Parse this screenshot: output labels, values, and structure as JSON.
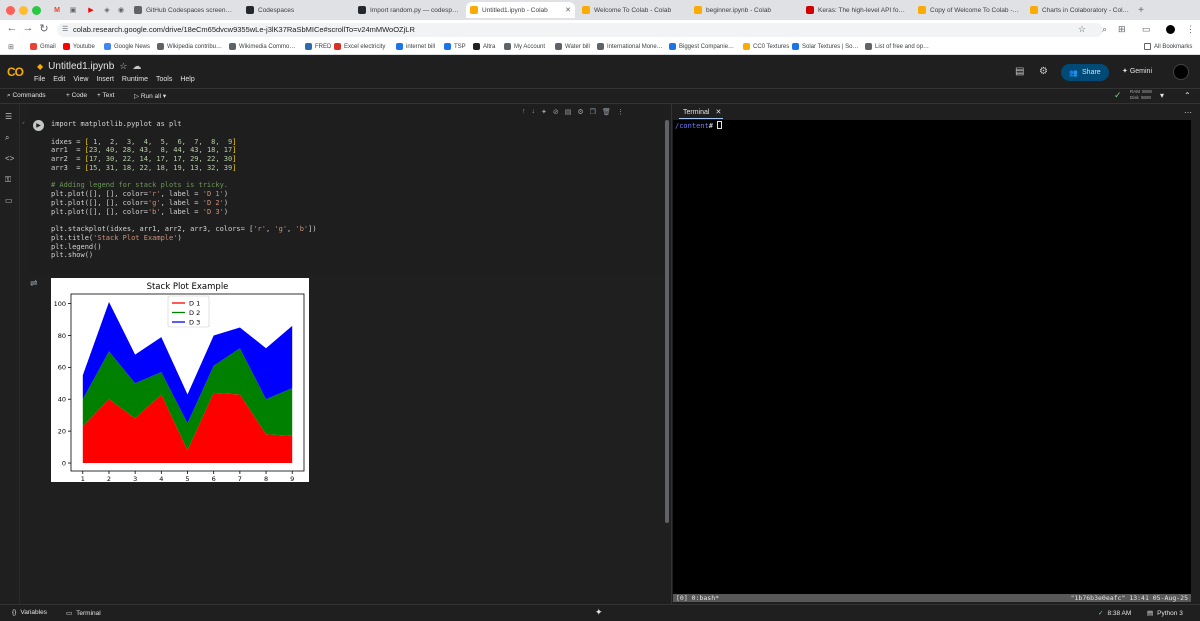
{
  "browser": {
    "tabs": [
      {
        "title": "GitHub Codespaces screens…",
        "icon": "wikipedia-icon",
        "color": "#5f6368",
        "active": false
      },
      {
        "title": "Codespaces",
        "icon": "github-icon",
        "color": "#24292f",
        "active": false
      },
      {
        "title": "Import random.py — codesp…",
        "icon": "github-icon",
        "color": "#24292f",
        "active": false
      },
      {
        "title": "Untitled1.ipynb - Colab",
        "icon": "colab-icon",
        "color": "#f9ab00",
        "active": true
      },
      {
        "title": "Welcome To Colab - Colab",
        "icon": "colab-icon",
        "color": "#f9ab00",
        "active": false
      },
      {
        "title": "beginner.ipynb - Colab",
        "icon": "colab-icon",
        "color": "#f9ab00",
        "active": false
      },
      {
        "title": "Keras: The high-level API fo…",
        "icon": "keras-icon",
        "color": "#d00000",
        "active": false
      },
      {
        "title": "Copy of Welcome To Colab -…",
        "icon": "colab-icon",
        "color": "#f9ab00",
        "active": false
      },
      {
        "title": "Charts in Colaboratory - Col…",
        "icon": "colab-icon",
        "color": "#f9ab00",
        "active": false
      }
    ],
    "url": "colab.research.google.com/drive/18eCm65dvcw9355wLe-j3lK37RaSbMICe#scrollTo=v24mMWoOZjLR",
    "bookmarks": [
      {
        "label": "Gmail",
        "color": "#ea4335"
      },
      {
        "label": "Youtube",
        "color": "#ff0000"
      },
      {
        "label": "Google News",
        "color": "#4285f4"
      },
      {
        "label": "Wikipedia contribu…",
        "color": "#5f6368"
      },
      {
        "label": "Wikimedia Commo…",
        "color": "#5f6368"
      },
      {
        "label": "FRED",
        "color": "#2b6cb0"
      },
      {
        "label": "Excel electricity",
        "color": "#d93025"
      },
      {
        "label": "internet bill",
        "color": "#1a73e8"
      },
      {
        "label": "TSP",
        "color": "#1a73e8"
      },
      {
        "label": "Altra",
        "color": "#202124"
      },
      {
        "label": "My Account",
        "color": "#5f6368"
      },
      {
        "label": "Water bill",
        "color": "#5f6368"
      },
      {
        "label": "International Mone…",
        "color": "#5f6368"
      },
      {
        "label": "Biggest Companie…",
        "color": "#1a73e8"
      },
      {
        "label": "CC0 Textures",
        "color": "#f9ab00"
      },
      {
        "label": "Solar Textures | So…",
        "color": "#1a73e8"
      },
      {
        "label": "List of free and op…",
        "color": "#5f6368"
      }
    ],
    "all_bookmarks": "All Bookmarks"
  },
  "colab": {
    "title": "Untitled1.ipynb",
    "menus": [
      "File",
      "Edit",
      "View",
      "Insert",
      "Runtime",
      "Tools",
      "Help"
    ],
    "share": "Share",
    "gemini": "Gemini",
    "toolbar": {
      "commands": "Commands",
      "code": "+ Code",
      "text": "+ Text",
      "run_all": "Run all"
    },
    "ram_label": "RAM",
    "disk_label": "Disk",
    "accent": "#f9ab00"
  },
  "cell": {
    "lines": [
      [
        {
          "t": "import matplotlib.pyplot as plt",
          "c": ""
        }
      ],
      [
        {
          "t": "",
          "c": ""
        }
      ],
      [
        {
          "t": "idxes = ",
          "c": ""
        },
        {
          "t": "[",
          "c": "brk"
        },
        {
          "t": " 1,  2,  3,  4,  5,  6,  7,  8,  9",
          "c": "num"
        },
        {
          "t": "]",
          "c": "brk"
        }
      ],
      [
        {
          "t": "arr1  = ",
          "c": ""
        },
        {
          "t": "[",
          "c": "brk"
        },
        {
          "t": "23, 40, 28, 43,  8, 44, 43, 18, 17",
          "c": "num"
        },
        {
          "t": "]",
          "c": "brk"
        }
      ],
      [
        {
          "t": "arr2  = ",
          "c": ""
        },
        {
          "t": "[",
          "c": "brk"
        },
        {
          "t": "17, 30, 22, 14, 17, 17, 29, 22, 30",
          "c": "num"
        },
        {
          "t": "]",
          "c": "brk"
        }
      ],
      [
        {
          "t": "arr3  = ",
          "c": ""
        },
        {
          "t": "[",
          "c": "brk"
        },
        {
          "t": "15, 31, 18, 22, 18, 19, 13, 32, 39",
          "c": "num"
        },
        {
          "t": "]",
          "c": "brk"
        }
      ],
      [
        {
          "t": "",
          "c": ""
        }
      ],
      [
        {
          "t": "# Adding legend for stack plots is tricky.",
          "c": "cm"
        }
      ],
      [
        {
          "t": "plt.plot([], [], color=",
          "c": ""
        },
        {
          "t": "'r'",
          "c": "str"
        },
        {
          "t": ", label = ",
          "c": ""
        },
        {
          "t": "'D 1'",
          "c": "str"
        },
        {
          "t": ")",
          "c": ""
        }
      ],
      [
        {
          "t": "plt.plot([], [], color=",
          "c": ""
        },
        {
          "t": "'g'",
          "c": "str"
        },
        {
          "t": ", label = ",
          "c": ""
        },
        {
          "t": "'D 2'",
          "c": "str"
        },
        {
          "t": ")",
          "c": ""
        }
      ],
      [
        {
          "t": "plt.plot([], [], color=",
          "c": ""
        },
        {
          "t": "'b'",
          "c": "str"
        },
        {
          "t": ", label = ",
          "c": ""
        },
        {
          "t": "'D 3'",
          "c": "str"
        },
        {
          "t": ")",
          "c": ""
        }
      ],
      [
        {
          "t": "",
          "c": ""
        }
      ],
      [
        {
          "t": "plt.stackplot(idxes, arr1, arr2, arr3, colors= [",
          "c": ""
        },
        {
          "t": "'r'",
          "c": "str"
        },
        {
          "t": ", ",
          "c": ""
        },
        {
          "t": "'g'",
          "c": "str"
        },
        {
          "t": ", ",
          "c": ""
        },
        {
          "t": "'b'",
          "c": "str"
        },
        {
          "t": "])",
          "c": ""
        }
      ],
      [
        {
          "t": "plt.title(",
          "c": ""
        },
        {
          "t": "'Stack Plot Example'",
          "c": "str"
        },
        {
          "t": ")",
          "c": ""
        }
      ],
      [
        {
          "t": "plt.legend()",
          "c": ""
        }
      ],
      [
        {
          "t": "plt.show()",
          "c": ""
        }
      ]
    ]
  },
  "chart_data": {
    "type": "area",
    "title": "Stack Plot Example",
    "x": [
      1,
      2,
      3,
      4,
      5,
      6,
      7,
      8,
      9
    ],
    "series": [
      {
        "name": "D 1",
        "color": "#ff0000",
        "values": [
          23,
          40,
          28,
          43,
          8,
          44,
          43,
          18,
          17
        ]
      },
      {
        "name": "D 2",
        "color": "#008000",
        "values": [
          17,
          30,
          22,
          14,
          17,
          17,
          29,
          22,
          30
        ]
      },
      {
        "name": "D 3",
        "color": "#0000ff",
        "values": [
          15,
          31,
          18,
          22,
          18,
          19,
          13,
          32,
          39
        ]
      }
    ],
    "xticks": [
      "1",
      "2",
      "3",
      "4",
      "5",
      "6",
      "7",
      "8",
      "9"
    ],
    "yticks": [
      "0",
      "20",
      "40",
      "60",
      "80",
      "100"
    ],
    "ytick_values": [
      0,
      20,
      40,
      60,
      80,
      100
    ],
    "xlim": [
      0.55,
      9.45
    ],
    "ylim": [
      -5,
      106
    ],
    "legend": "top-center",
    "stacked": true
  },
  "terminal": {
    "tab_label": "Terminal",
    "prompt_dir": "/content",
    "prompt_suffix": "# ",
    "status_left": "[0] 0:bash*",
    "status_right": "\"1b76b3e0eafc\" 13:41 05-Aug-25"
  },
  "footer": {
    "variables": "Variables",
    "terminal": "Terminal",
    "time": "8:38 AM",
    "runtime": "Python 3"
  }
}
